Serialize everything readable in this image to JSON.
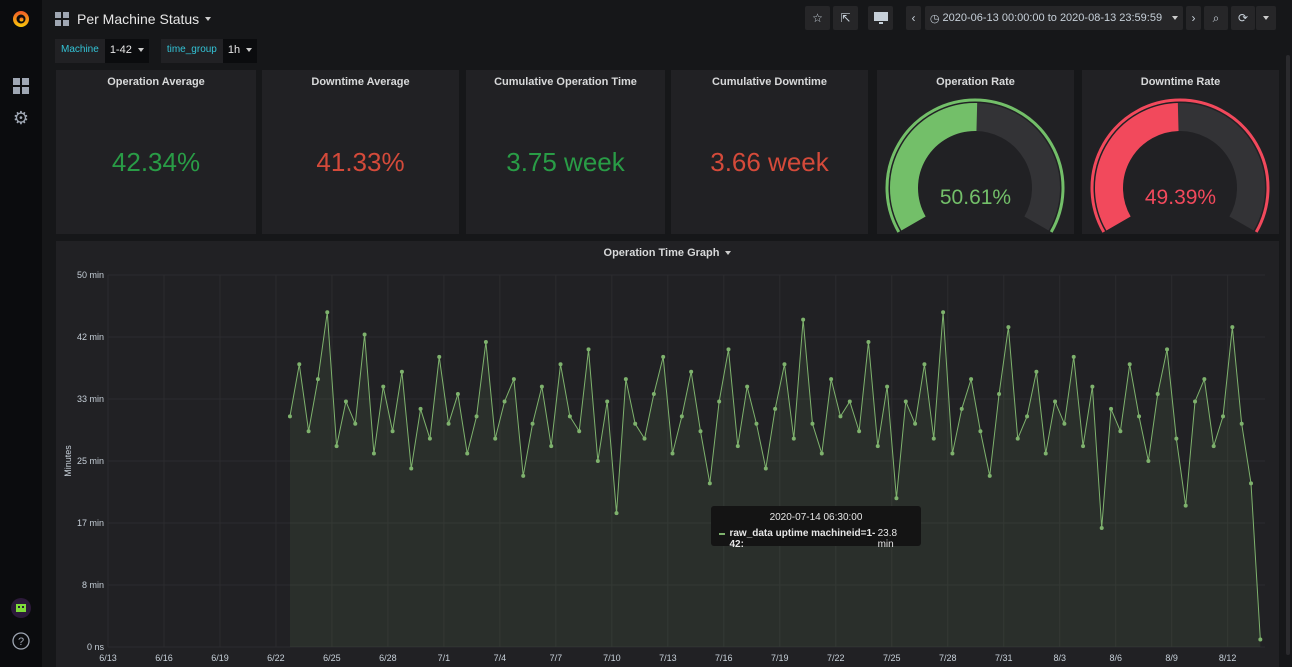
{
  "header": {
    "title": "Per Machine Status",
    "time_range": "2020-06-13 00:00:00 to 2020-08-13 23:59:59"
  },
  "variables": [
    {
      "label": "Machine",
      "value": "1-42"
    },
    {
      "label": "time_group",
      "value": "1h"
    }
  ],
  "icons": [
    "grafana-logo",
    "dashboards-icon",
    "gear-icon",
    "user-avatar",
    "help-icon",
    "star-icon",
    "share-icon",
    "tv-icon",
    "chevron-left-icon",
    "clock-icon",
    "chevron-right-icon",
    "zoom-out-icon",
    "refresh-icon"
  ],
  "colors": {
    "green": "#299c46",
    "red": "#d44a3a",
    "gauge_green": "#73bf69",
    "gauge_red": "#f2495c",
    "series": "#7eb26d"
  },
  "stats": [
    {
      "title": "Operation Average",
      "value": "42.34%",
      "color": "green"
    },
    {
      "title": "Downtime Average",
      "value": "41.33%",
      "color": "red"
    },
    {
      "title": "Cumulative Operation Time",
      "value": "3.75 week",
      "color": "green"
    },
    {
      "title": "Cumulative Downtime",
      "value": "3.66 week",
      "color": "red"
    }
  ],
  "gauges": [
    {
      "title": "Operation Rate",
      "value": "50.61%",
      "percent": 50.61,
      "color": "gauge_green"
    },
    {
      "title": "Downtime Rate",
      "value": "49.39%",
      "percent": 49.39,
      "color": "gauge_red"
    }
  ],
  "graph": {
    "title": "Operation Time Graph"
  },
  "tooltip": {
    "time": "2020-07-14 06:30:00",
    "series": "raw_data uptime machineid=1-42:",
    "value": "23.8 min"
  },
  "chart_data": {
    "type": "line",
    "ylabel": "Minutes",
    "ylim": [
      0,
      50
    ],
    "yticks": [
      "0 ns",
      "8 min",
      "17 min",
      "25 min",
      "33 min",
      "42 min",
      "50 min"
    ],
    "xlim": [
      "2020-06-13",
      "2020-08-14"
    ],
    "xticks": [
      "6/13",
      "6/16",
      "6/19",
      "6/22",
      "6/25",
      "6/28",
      "7/1",
      "7/4",
      "7/7",
      "7/10",
      "7/13",
      "7/16",
      "7/19",
      "7/22",
      "7/25",
      "7/28",
      "7/31",
      "8/3",
      "8/6",
      "8/9",
      "8/12"
    ],
    "grid": true,
    "series": [
      {
        "name": "raw_data uptime machineid=1-42",
        "values": [
          31,
          38,
          29,
          36,
          45,
          27,
          33,
          30,
          42,
          26,
          35,
          29,
          37,
          24,
          32,
          28,
          39,
          30,
          34,
          26,
          31,
          41,
          28,
          33,
          36,
          23,
          30,
          35,
          27,
          38,
          31,
          29,
          40,
          25,
          33,
          18,
          36,
          30,
          28,
          34,
          39,
          26,
          31,
          37,
          29,
          22,
          33,
          40,
          27,
          35,
          30,
          24,
          32,
          38,
          28,
          44,
          30,
          26,
          36,
          31,
          33,
          29,
          41,
          27,
          35,
          20,
          33,
          30,
          38,
          28,
          45,
          26,
          32,
          36,
          29,
          23,
          34,
          43,
          28,
          31,
          37,
          26,
          33,
          30,
          39,
          27,
          35,
          16,
          32,
          29,
          38,
          31,
          25,
          34,
          40,
          28,
          19,
          33,
          36,
          27,
          31,
          43,
          30,
          22,
          1
        ],
        "start": "2020-06-22 18:00",
        "interval": "12h"
      }
    ]
  }
}
